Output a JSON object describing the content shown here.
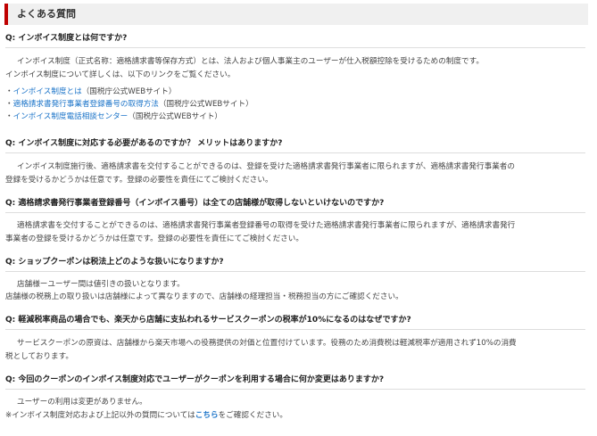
{
  "header": {
    "title": "よくある質問"
  },
  "faq": [
    {
      "question": "Q: インボイス制度とは何ですか?",
      "answer_lines": [
        "インボイス制度（正式名称：適格請求書等保存方式）とは、法人および個人事業主のユーザーが仕入税額控除を受けるための制度です。",
        "インボイス制度について詳しくは、以下のリンクをご覧ください。"
      ],
      "links": [
        {
          "bullet": "・",
          "text": "インボイス制度とは",
          "note": "（国税庁公式WEBサイト）"
        },
        {
          "bullet": "・",
          "text": "適格請求書発行事業者登録番号の取得方法",
          "note": "（国税庁公式WEBサイト）"
        },
        {
          "bullet": "・",
          "text": "インボイス制度電話相談センター",
          "note": "（国税庁公式WEBサイト）"
        }
      ]
    },
    {
      "question": "Q: インボイス制度に対応する必要があるのですか？ メリットはありますか?",
      "answer_lines": [
        "インボイス制度施行後、適格請求書を交付することができるのは、登録を受けた適格請求書発行事業者に限られますが、適格請求書発行事業者の",
        "登録を受けるかどうかは任意です。登録の必要性を責任にてご検討ください。"
      ]
    },
    {
      "question": "Q: 適格請求書発行事業者登録番号（インボイス番号）は全ての店舗様が取得しないといけないのですか?",
      "answer_lines": [
        "適格請求書を交付することができるのは、適格請求書発行事業者登録番号の取得を受けた適格請求書発行事業者に限られますが、適格請求書発行",
        "事業者の登録を受けるかどうかは任意です。登録の必要性を責任にてご検討ください。"
      ]
    },
    {
      "question": "Q: ショップクーポンは税法上どのような扱いになりますか?",
      "answer_lines": [
        "店舗様ーユーザー間は値引きの扱いとなります。",
        "店舗様の税務上の取り扱いは店舗様によって異なりますので、店舗様の経理担当・税務担当の方にご確認ください。"
      ]
    },
    {
      "question": "Q: 軽減税率商品の場合でも、楽天から店舗に支払われるサービスクーポンの税率が10%になるのはなぜですか?",
      "answer_lines": [
        "サービスクーポンの原資は、店舗様から楽天市場への役務提供の対価と位置付けています。役務のため消費税は軽減税率が適用されず10%の消費",
        "税としております。"
      ]
    },
    {
      "question": "Q: 今回のクーポンのインボイス制度対応でユーザーがクーポンを利用する場合に何か変更はありますか?",
      "answer_lines": [
        "ユーザーの利用は変更がありません。"
      ],
      "note": {
        "prefix": "※インボイス制度対応および上記以外の質問については",
        "link": "こちら",
        "suffix": "をご確認ください。"
      }
    }
  ]
}
